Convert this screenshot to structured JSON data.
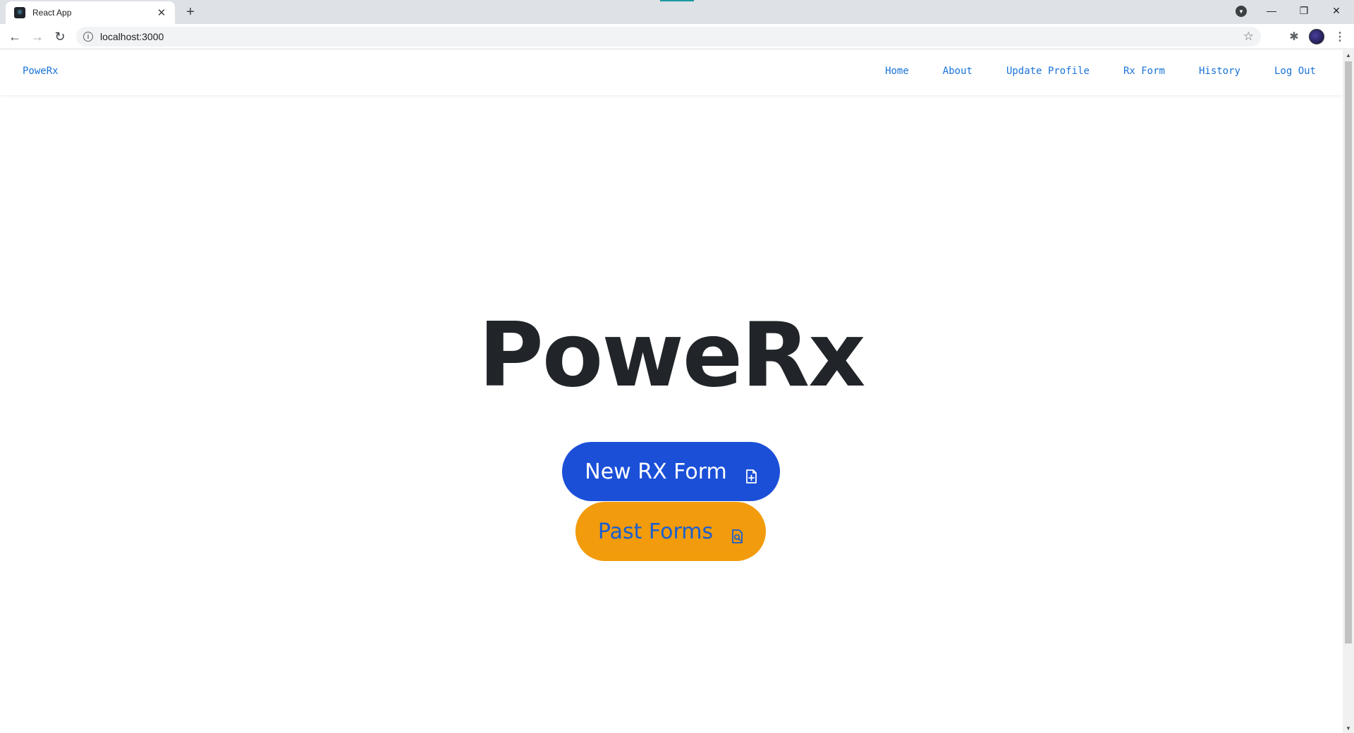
{
  "browser": {
    "tab_title": "React App",
    "tab_close": "✕",
    "new_tab": "+",
    "url": "localhost:3000",
    "back": "←",
    "forward": "→",
    "reload": "↻",
    "star": "☆",
    "extensions": "✱",
    "menu": "⋮",
    "minimize": "—",
    "restore": "❐",
    "close": "✕"
  },
  "navbar": {
    "brand": "PoweRx",
    "links": [
      {
        "label": "Home"
      },
      {
        "label": "About"
      },
      {
        "label": "Update Profile"
      },
      {
        "label": "Rx Form"
      },
      {
        "label": "History"
      },
      {
        "label": "Log Out"
      }
    ]
  },
  "hero": {
    "title": "PoweRx",
    "new_form_button": "New RX Form",
    "past_forms_button": "Past Forms"
  },
  "colors": {
    "primary_button": "#1b4fd8",
    "secondary_button": "#f29b0c",
    "link": "#1a73d9",
    "title": "#212529"
  },
  "icons": {
    "new_form": "file-plus-icon",
    "past_forms": "file-search-icon"
  }
}
